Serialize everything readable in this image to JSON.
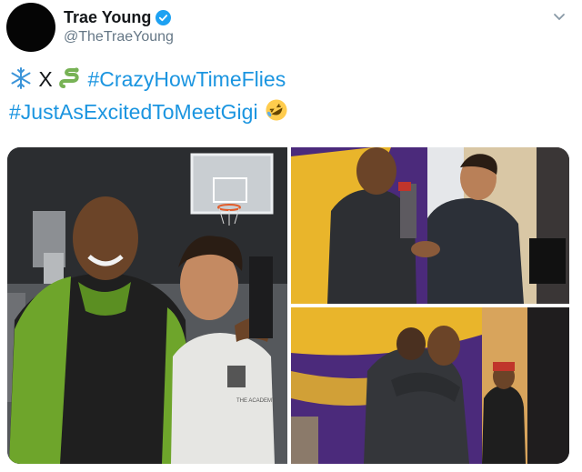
{
  "user": {
    "display_name": "Trae Young",
    "handle": "@TheTraeYoung",
    "verified": true
  },
  "tweet": {
    "line1_mid": "X",
    "hashtag1": "#CrazyHowTimeFlies",
    "hashtag2": "#JustAsExcitedToMeetGigi"
  },
  "icons": {
    "verified": "verified-badge-icon",
    "caret": "chevron-down-icon",
    "emoji1": "snowflake-emoji-icon",
    "emoji2": "snake-emoji-icon",
    "emoji3": "rolling-on-floor-laughing-emoji-icon"
  },
  "photos": {
    "photo1_shirt_text": "THE ACADEMY"
  },
  "colors": {
    "link": "#1b95e0",
    "verified": "#1da1f2",
    "handle": "#657786",
    "text": "#14171a",
    "lakers_purple": "#4b2a7b",
    "lakers_gold": "#e9b52b"
  }
}
